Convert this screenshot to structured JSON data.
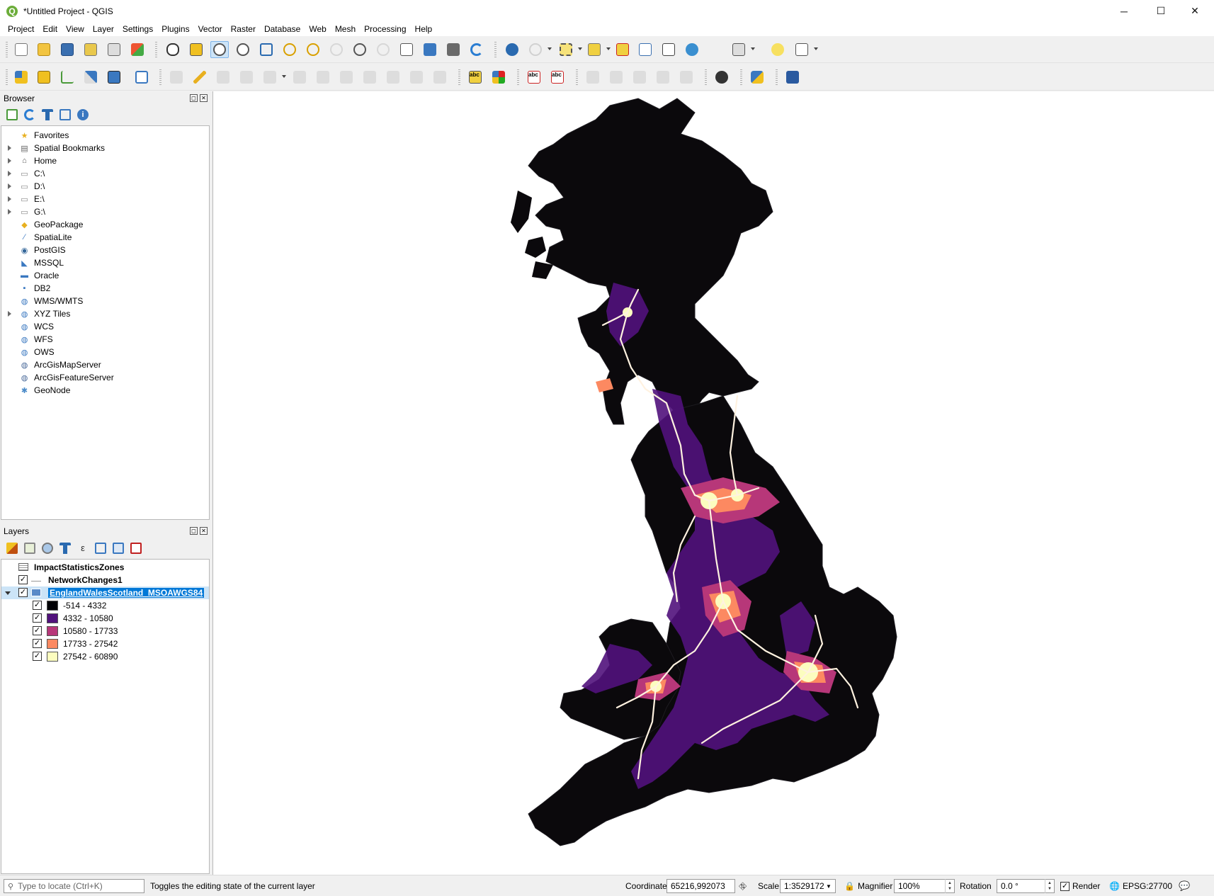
{
  "window": {
    "title": "*Untitled Project - QGIS",
    "app_icon_letter": "Q",
    "controls": {
      "minimize": "─",
      "maximize": "☐",
      "close": "✕"
    }
  },
  "menu": [
    "Project",
    "Edit",
    "View",
    "Layer",
    "Settings",
    "Plugins",
    "Vector",
    "Raster",
    "Database",
    "Web",
    "Mesh",
    "Processing",
    "Help"
  ],
  "toolbar2_labels": {
    "abc": "abc"
  },
  "browser": {
    "title": "Browser",
    "items": [
      {
        "label": "Favorites",
        "icon": "star-icon",
        "expandable": false
      },
      {
        "label": "Spatial Bookmarks",
        "icon": "bookmark-icon",
        "expandable": true
      },
      {
        "label": "Home",
        "icon": "home-folder-icon",
        "expandable": true
      },
      {
        "label": "C:\\",
        "icon": "folder-icon",
        "expandable": true
      },
      {
        "label": "D:\\",
        "icon": "folder-icon",
        "expandable": true
      },
      {
        "label": "E:\\",
        "icon": "folder-icon",
        "expandable": true
      },
      {
        "label": "G:\\",
        "icon": "folder-icon",
        "expandable": true
      },
      {
        "label": "GeoPackage",
        "icon": "geopackage-icon",
        "expandable": false
      },
      {
        "label": "SpatiaLite",
        "icon": "spatialite-icon",
        "expandable": false
      },
      {
        "label": "PostGIS",
        "icon": "postgis-icon",
        "expandable": false
      },
      {
        "label": "MSSQL",
        "icon": "mssql-icon",
        "expandable": false
      },
      {
        "label": "Oracle",
        "icon": "oracle-icon",
        "expandable": false
      },
      {
        "label": "DB2",
        "icon": "db2-icon",
        "expandable": false
      },
      {
        "label": "WMS/WMTS",
        "icon": "globe-icon",
        "expandable": false
      },
      {
        "label": "XYZ Tiles",
        "icon": "globe-icon",
        "expandable": true
      },
      {
        "label": "WCS",
        "icon": "globe-icon",
        "expandable": false
      },
      {
        "label": "WFS",
        "icon": "globe-icon",
        "expandable": false
      },
      {
        "label": "OWS",
        "icon": "globe-icon",
        "expandable": false
      },
      {
        "label": "ArcGisMapServer",
        "icon": "arcgis-icon",
        "expandable": false
      },
      {
        "label": "ArcGisFeatureServer",
        "icon": "arcgis-icon",
        "expandable": false
      },
      {
        "label": "GeoNode",
        "icon": "geonode-icon",
        "expandable": false
      }
    ]
  },
  "layers": {
    "title": "Layers",
    "items": [
      {
        "label": "ImpactStatisticsZones",
        "checkbox": false,
        "bold": true,
        "selected": false
      },
      {
        "label": "NetworkChanges1",
        "checkbox": true,
        "bold": true,
        "selected": false
      },
      {
        "label": "EnglandWalesScotland_MSOAWGS84",
        "checkbox": true,
        "bold": false,
        "selected": true
      }
    ],
    "legend": [
      {
        "label": "-514 - 4332",
        "color": "#000004"
      },
      {
        "label": "4332 - 10580",
        "color": "#51127c"
      },
      {
        "label": "10580 - 17733",
        "color": "#b73779"
      },
      {
        "label": "17733 - 27542",
        "color": "#fc8961"
      },
      {
        "label": "27542 - 60890",
        "color": "#fcfdbf"
      }
    ]
  },
  "status": {
    "locate_placeholder": "Type to locate (Ctrl+K)",
    "message": "Toggles the editing state of the current layer",
    "coordinate_label": "Coordinate",
    "coordinate_value": "65216,992073",
    "scale_label": "Scale",
    "scale_value": "1:3529172",
    "magnifier_label": "Magnifier",
    "magnifier_value": "100%",
    "rotation_label": "Rotation",
    "rotation_value": "0.0 °",
    "render_label": "Render",
    "crs": "EPSG:27700"
  },
  "colors": {
    "land": "#0b090c",
    "accent": "#0078d7",
    "selection": "#0078d7"
  }
}
